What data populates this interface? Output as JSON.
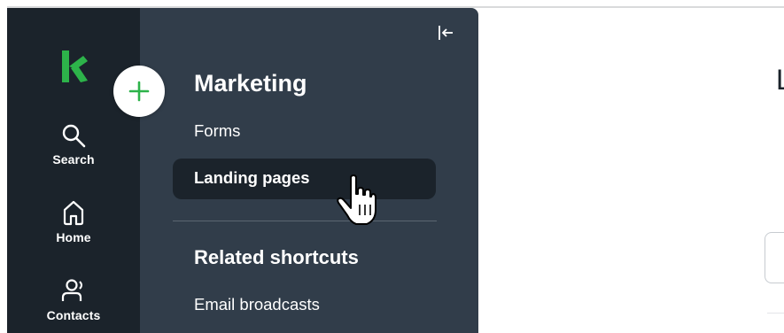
{
  "rail": {
    "items": [
      {
        "label": "Search",
        "icon": "search-icon"
      },
      {
        "label": "Home",
        "icon": "home-icon"
      },
      {
        "label": "Contacts",
        "icon": "contacts-icon"
      }
    ]
  },
  "panel": {
    "title": "Marketing",
    "links": [
      "Forms",
      "Landing pages"
    ],
    "active_link": "Landing pages",
    "related_title": "Related shortcuts",
    "related_links": [
      "Email broadcasts"
    ]
  },
  "main": {
    "heading_fragment": "L"
  },
  "colors": {
    "rail_bg": "#1b232b",
    "panel_bg": "#313d4a",
    "brand_green": "#2db34a",
    "active_bg": "#1b232b"
  }
}
